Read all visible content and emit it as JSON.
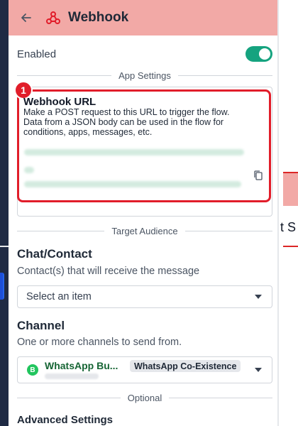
{
  "header": {
    "title": "Webhook"
  },
  "enabled": {
    "label": "Enabled",
    "on": true
  },
  "app_settings": {
    "divider": "App Settings",
    "webhook_url": {
      "title": "Webhook URL",
      "description": "Make a POST request to this URL to trigger the flow. Data from a JSON body can be used in the flow for conditions, apps, messages, etc.",
      "badge": "1"
    }
  },
  "target_audience": {
    "divider": "Target Audience",
    "chat": {
      "title": "Chat/Contact",
      "subtitle": "Contact(s) that will receive the message",
      "placeholder": "Select an item"
    },
    "channel": {
      "title": "Channel",
      "subtitle": "One or more channels to send from.",
      "selected_name": "WhatsApp Bu...",
      "selected_tag": "WhatsApp Co-Existence"
    }
  },
  "optional": {
    "divider": "Optional",
    "advanced": "Advanced Settings"
  },
  "background": {
    "canvas_text": "t S"
  },
  "colors": {
    "header_bg": "#f2a9a6",
    "toggle_on": "#15a37f",
    "highlight": "#e11d2a",
    "whatsapp": "#22c55e"
  },
  "icons": [
    "back-arrow-icon",
    "webhook-icon",
    "copy-icon",
    "chevron-down-icon",
    "whatsapp-icon"
  ]
}
